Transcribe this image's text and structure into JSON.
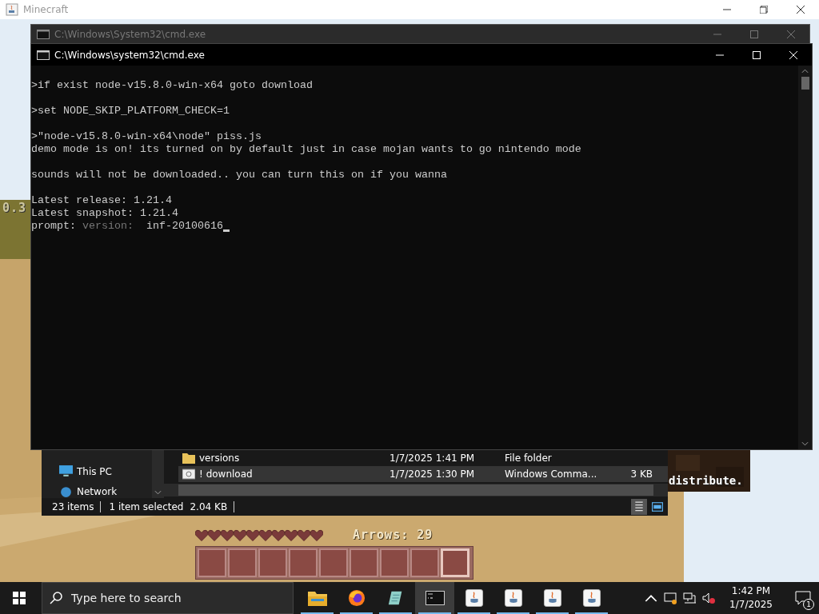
{
  "game_window": {
    "title": "Minecraft",
    "hud": {
      "corner_text": "0.3",
      "world_text": "distribute.",
      "arrows": "Arrows: 29",
      "hearts": [
        {
          "full": true
        },
        {
          "full": true
        },
        {
          "full": true
        },
        {
          "full": true
        },
        {
          "full": true
        },
        {
          "full": true
        },
        {
          "full": true
        },
        {
          "full": true
        },
        {
          "full": true
        },
        {
          "full": true
        }
      ],
      "hotbar": [
        {
          "selected": false
        },
        {
          "selected": false
        },
        {
          "selected": false
        },
        {
          "selected": false
        },
        {
          "selected": false
        },
        {
          "selected": false
        },
        {
          "selected": false
        },
        {
          "selected": false
        },
        {
          "selected": true
        }
      ]
    }
  },
  "explorer": {
    "nav": [
      {
        "label": "This PC",
        "kind": "pc"
      },
      {
        "label": "Network",
        "kind": "network"
      }
    ],
    "rows": [
      {
        "kind": "folder",
        "name": "versions",
        "date": "1/7/2025 1:41 PM",
        "type": "File folder",
        "selected": false
      },
      {
        "kind": "script",
        "name": "! download",
        "date": "1/7/2025 1:30 PM",
        "type": "Windows Comma...",
        "size": "3 KB",
        "selected": true
      }
    ],
    "status": [
      "23 items",
      "1 item selected",
      "2.04 KB"
    ]
  },
  "console_back": {
    "title": "C:\\Windows\\System32\\cmd.exe"
  },
  "console": {
    "title": "C:\\Windows\\system32\\cmd.exe",
    "lines": [
      {
        "kind": "blank"
      },
      {
        "kind": "text",
        "text": ">if exist node-v15.8.0-win-x64 goto download"
      },
      {
        "kind": "blank"
      },
      {
        "kind": "text",
        "text": ">set NODE_SKIP_PLATFORM_CHECK=1"
      },
      {
        "kind": "blank"
      },
      {
        "kind": "text",
        "text": ">\"node-v15.8.0-win-x64\\node\" piss.js"
      },
      {
        "kind": "text",
        "text": "demo mode is on! its turned on by default just in case mojan wants to go nintendo mode"
      },
      {
        "kind": "blank"
      },
      {
        "kind": "text",
        "text": "sounds will not be downloaded.. you can turn this on if you wanna"
      },
      {
        "kind": "blank"
      },
      {
        "kind": "text",
        "text": "Latest release: 1.21.4"
      },
      {
        "kind": "text",
        "text": "Latest snapshot: 1.21.4"
      },
      {
        "kind": "prompt",
        "label": "prompt:",
        "field": "version:",
        "value": "inf-20100616"
      }
    ]
  },
  "taskbar": {
    "search": {
      "placeholder": "Type here to search"
    },
    "apps": [
      {
        "kind": "folder",
        "selected": false
      },
      {
        "kind": "browser",
        "selected": false
      },
      {
        "kind": "notepad",
        "selected": false
      },
      {
        "kind": "terminal",
        "selected": true
      },
      {
        "kind": "java",
        "selected": false
      },
      {
        "kind": "java",
        "selected": false
      },
      {
        "kind": "java",
        "selected": false
      },
      {
        "kind": "java",
        "selected": false
      }
    ],
    "time": "1:42 PM",
    "date": "1/7/2025",
    "notifications": "1"
  }
}
